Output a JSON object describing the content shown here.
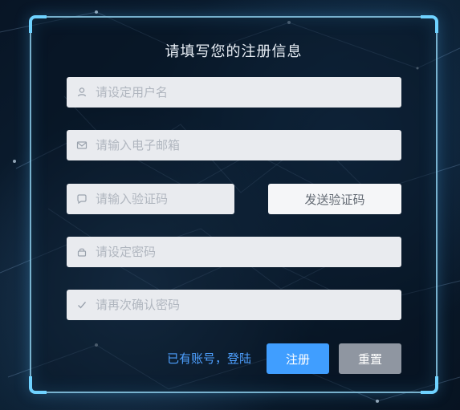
{
  "form": {
    "title": "请填写您的注册信息",
    "username": {
      "placeholder": "请设定用户名",
      "icon": "user-icon"
    },
    "email": {
      "placeholder": "请输入电子邮箱",
      "icon": "mail-icon"
    },
    "verification_code": {
      "placeholder": "请输入验证码",
      "icon": "chat-icon"
    },
    "send_code_label": "发送验证码",
    "password": {
      "placeholder": "请设定密码",
      "icon": "lock-icon"
    },
    "confirm_password": {
      "placeholder": "请再次确认密码",
      "icon": "check-icon"
    },
    "login_link": "已有账号，登陆",
    "register_label": "注册",
    "reset_label": "重置"
  },
  "colors": {
    "primary": "#409eff",
    "reset": "#8f96a1",
    "link": "#4ea0ff",
    "input_bg": "#e9ebef",
    "text": "#e8eef5"
  }
}
